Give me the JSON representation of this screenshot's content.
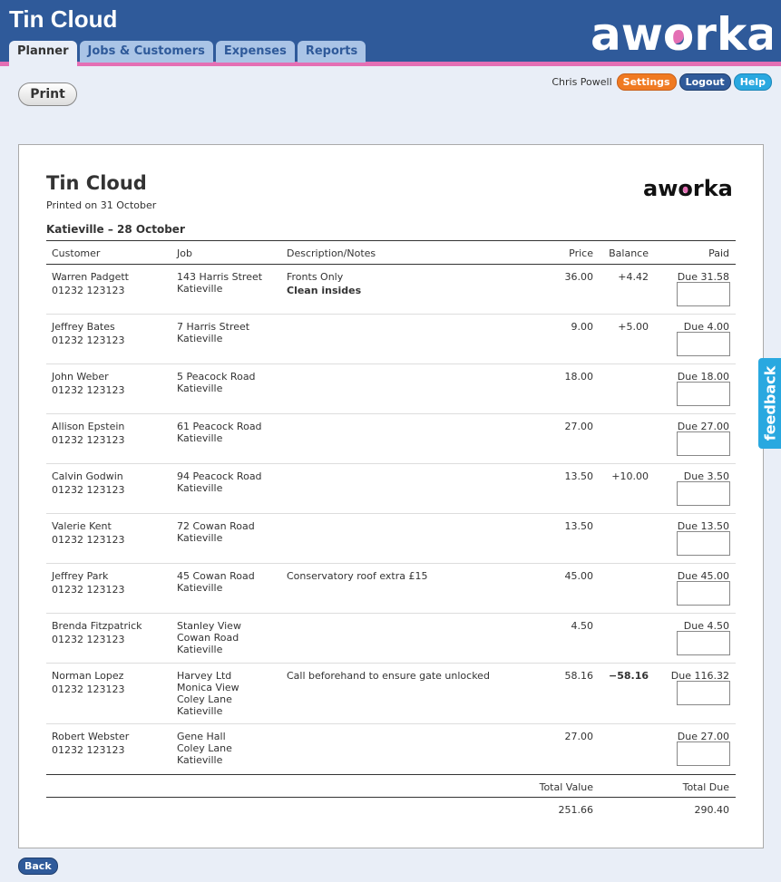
{
  "app": {
    "title": "Tin Cloud",
    "logo_text": "aworka"
  },
  "tabs": [
    {
      "label": "Planner"
    },
    {
      "label": "Jobs & Customers"
    },
    {
      "label": "Expenses"
    },
    {
      "label": "Reports"
    }
  ],
  "user": {
    "name": "Chris Powell",
    "settings": "Settings",
    "logout": "Logout",
    "help": "Help"
  },
  "print_label": "Print",
  "doc": {
    "title": "Tin Cloud",
    "printed_on": "Printed on 31 October",
    "route": "Katieville – 28 October"
  },
  "columns": {
    "customer": "Customer",
    "job": "Job",
    "desc": "Description/Notes",
    "price": "Price",
    "balance": "Balance",
    "paid": "Paid"
  },
  "rows": [
    {
      "name": "Warren Padgett",
      "phone": "01232 123123",
      "job": [
        "143 Harris Street",
        "Katieville"
      ],
      "desc": "Fronts Only",
      "desc2": "Clean insides",
      "price": "36.00",
      "balance": "+4.42",
      "due": "Due 31.58"
    },
    {
      "name": "Jeffrey Bates",
      "phone": "01232 123123",
      "job": [
        "7 Harris Street",
        "Katieville"
      ],
      "desc": "",
      "desc2": "",
      "price": "9.00",
      "balance": "+5.00",
      "due": "Due 4.00"
    },
    {
      "name": "John Weber",
      "phone": "01232 123123",
      "job": [
        "5 Peacock Road",
        "Katieville"
      ],
      "desc": "",
      "desc2": "",
      "price": "18.00",
      "balance": "",
      "due": "Due 18.00"
    },
    {
      "name": "Allison Epstein",
      "phone": "01232 123123",
      "job": [
        "61 Peacock Road",
        "Katieville"
      ],
      "desc": "",
      "desc2": "",
      "price": "27.00",
      "balance": "",
      "due": "Due 27.00"
    },
    {
      "name": "Calvin Godwin",
      "phone": "01232 123123",
      "job": [
        "94 Peacock Road",
        "Katieville"
      ],
      "desc": "",
      "desc2": "",
      "price": "13.50",
      "balance": "+10.00",
      "due": "Due 3.50"
    },
    {
      "name": "Valerie Kent",
      "phone": "01232 123123",
      "job": [
        "72 Cowan Road",
        "Katieville"
      ],
      "desc": "",
      "desc2": "",
      "price": "13.50",
      "balance": "",
      "due": "Due 13.50"
    },
    {
      "name": "Jeffrey Park",
      "phone": "01232 123123",
      "job": [
        "45 Cowan Road",
        "Katieville"
      ],
      "desc": "Conservatory roof extra £15",
      "desc2": "",
      "price": "45.00",
      "balance": "",
      "due": "Due 45.00"
    },
    {
      "name": "Brenda Fitzpatrick",
      "phone": "01232 123123",
      "job": [
        "Stanley View",
        "Cowan Road",
        "Katieville"
      ],
      "desc": "",
      "desc2": "",
      "price": "4.50",
      "balance": "",
      "due": "Due 4.50"
    },
    {
      "name": "Norman Lopez",
      "phone": "01232 123123",
      "job": [
        "Harvey Ltd",
        "Monica View",
        "Coley Lane",
        "Katieville"
      ],
      "desc": "Call beforehand to ensure gate unlocked",
      "desc2": "",
      "price": "58.16",
      "balance": "−58.16",
      "due": "Due 116.32"
    },
    {
      "name": "Robert Webster",
      "phone": "01232 123123",
      "job": [
        "Gene Hall",
        "Coley Lane",
        "Katieville"
      ],
      "desc": "",
      "desc2": "",
      "price": "27.00",
      "balance": "",
      "due": "Due 27.00"
    }
  ],
  "totals": {
    "value_label": "Total Value",
    "due_label": "Total Due",
    "value": "251.66",
    "due": "290.40"
  },
  "feedback_label": "feedback",
  "back_label": "Back"
}
